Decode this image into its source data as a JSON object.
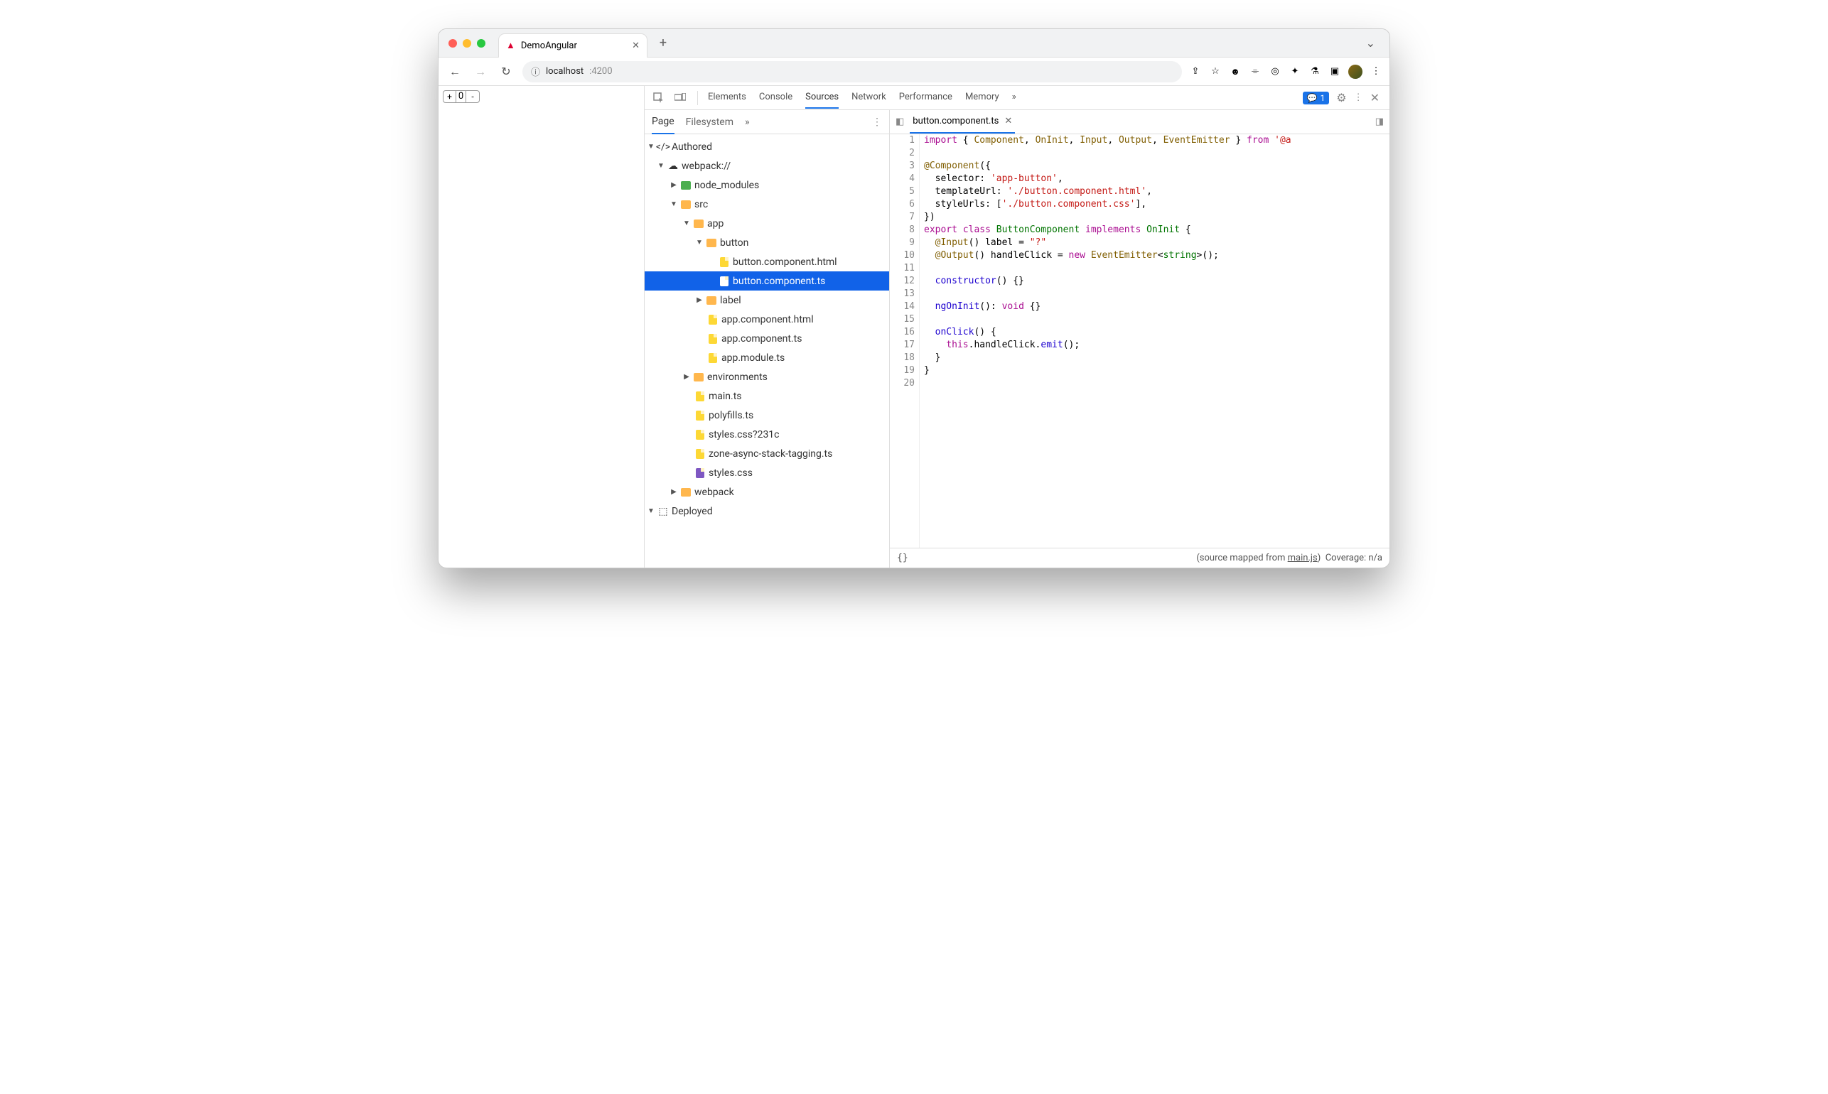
{
  "tab": {
    "title": "DemoAngular"
  },
  "url": {
    "host": "localhost",
    "port": ":4200"
  },
  "pageCounter": {
    "value": "0"
  },
  "devtools": {
    "tabs": [
      "Elements",
      "Console",
      "Sources",
      "Network",
      "Performance",
      "Memory"
    ],
    "badgeCount": "1",
    "navTabs": [
      "Page",
      "Filesystem"
    ],
    "tree": {
      "authored": "Authored",
      "webpack": "webpack://",
      "node_modules": "node_modules",
      "src": "src",
      "app": "app",
      "button": "button",
      "btn_html": "button.component.html",
      "btn_ts": "button.component.ts",
      "label_dir": "label",
      "app_html": "app.component.html",
      "app_ts": "app.component.ts",
      "app_mod": "app.module.ts",
      "env": "environments",
      "main": "main.ts",
      "poly": "polyfills.ts",
      "styles1": "styles.css?231c",
      "zone": "zone-async-stack-tagging.ts",
      "styles2": "styles.css",
      "webpack_dir": "webpack",
      "deployed": "Deployed"
    },
    "openFile": "button.component.ts",
    "code": {
      "1": "import { Component, OnInit, Input, Output, EventEmitter } from '@a",
      "2": "",
      "3": "@Component({",
      "4": "  selector: 'app-button',",
      "5": "  templateUrl: './button.component.html',",
      "6": "  styleUrls: ['./button.component.css'],",
      "7": "})",
      "8": "export class ButtonComponent implements OnInit {",
      "9": "  @Input() label = \"?\"",
      "10": "  @Output() handleClick = new EventEmitter<string>();",
      "11": "",
      "12": "  constructor() {}",
      "13": "",
      "14": "  ngOnInit(): void {}",
      "15": "",
      "16": "  onClick() {",
      "17": "    this.handleClick.emit();",
      "18": "  }",
      "19": "}",
      "20": ""
    },
    "status": {
      "mapped": "(source mapped from ",
      "mappedFile": "main.js",
      "mappedEnd": ")",
      "coverage": "Coverage: n/a"
    }
  }
}
